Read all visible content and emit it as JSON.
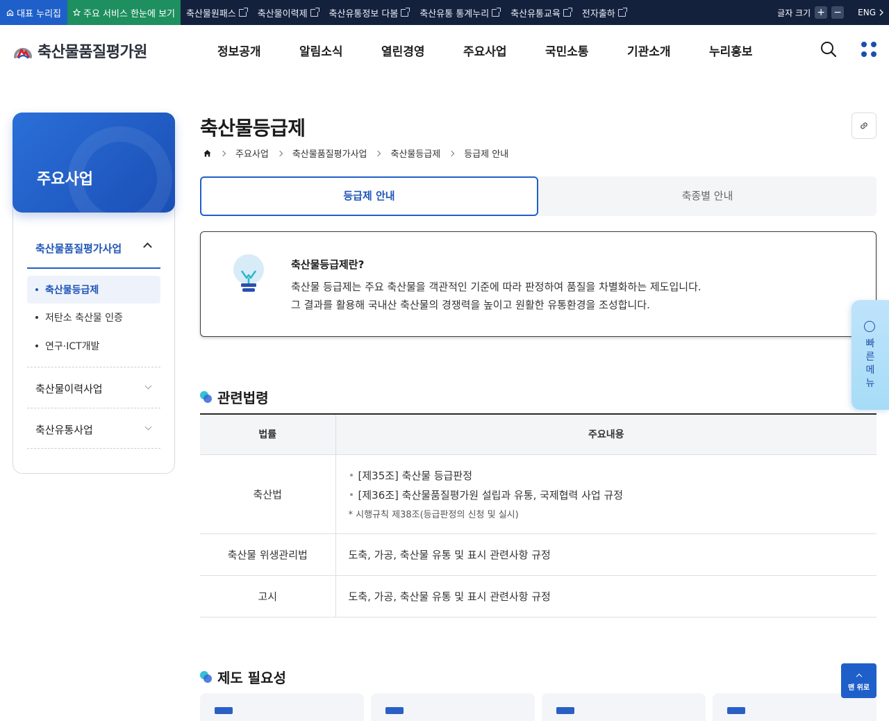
{
  "topbar": {
    "home_label": "대표 누리집",
    "all_services_label": "주요 서비스 한눈에 보기",
    "links": [
      "축산물원패스",
      "축산물이력제",
      "축산유통정보 다봄",
      "축산유통 통계누리",
      "축산유통교육",
      "전자출하"
    ],
    "font_size_label": "글자 크기",
    "font_plus": "+",
    "font_minus": "−",
    "lang_label": "ENG"
  },
  "header": {
    "logo_text": "축산물품질평가원",
    "nav": [
      "정보공개",
      "알림소식",
      "열린경영",
      "주요사업",
      "국민소통",
      "기관소개",
      "누리홍보"
    ]
  },
  "sidebar": {
    "title": "주요사업",
    "section_active": "축산물품질평가사업",
    "sub_items": [
      "축산물등급제",
      "저탄소 축산물 인증",
      "연구·ICT개발"
    ],
    "sections": [
      "축산물이력사업",
      "축산유통사업"
    ]
  },
  "page": {
    "title": "축산물등급제",
    "breadcrumb": [
      "주요사업",
      "축산물품질평가사업",
      "축산물등급제",
      "등급제 안내"
    ]
  },
  "tabs": {
    "active": "등급제 안내",
    "other": "축종별 안내"
  },
  "info": {
    "question": "축산물등급제란?",
    "line1": "축산물 등급제는 주요 축산물을 객관적인 기준에 따라 판정하여 품질을 차별화하는 제도입니다.",
    "line2": "그 결과를 활용해 국내산 축산물의 경쟁력을 높이고 원활한 유통환경을 조성합니다."
  },
  "quick_menu": {
    "label": [
      "빠",
      "른",
      "메",
      "뉴"
    ]
  },
  "laws": {
    "heading": "관련법령",
    "col_law": "법률",
    "col_content": "주요내용",
    "rows": [
      {
        "law": "축산법",
        "items": [
          "[제35조] 축산물 등급판정",
          "[제36조] 축산물품질평가원 설립과 유통, 국제협력 사업 규정"
        ],
        "note": "* 시행규칙 제38조(등급판정의 신청 및 실시)"
      },
      {
        "law": "축산물 위생관리법",
        "content": "도축, 가공, 축산물 유통 및 표시 관련사항 규정"
      },
      {
        "law": "고시",
        "content": "도축, 가공, 축산물 유통 및 표시 관련사항 규정"
      }
    ]
  },
  "necessity": {
    "heading": "제도 필요성"
  },
  "to_top": {
    "label": "맨 위로"
  },
  "colors": {
    "primary": "#1f5fc9",
    "topbar": "#14213d",
    "all_services": "#1e8f5e",
    "quick_menu": "#a6dcf7"
  }
}
